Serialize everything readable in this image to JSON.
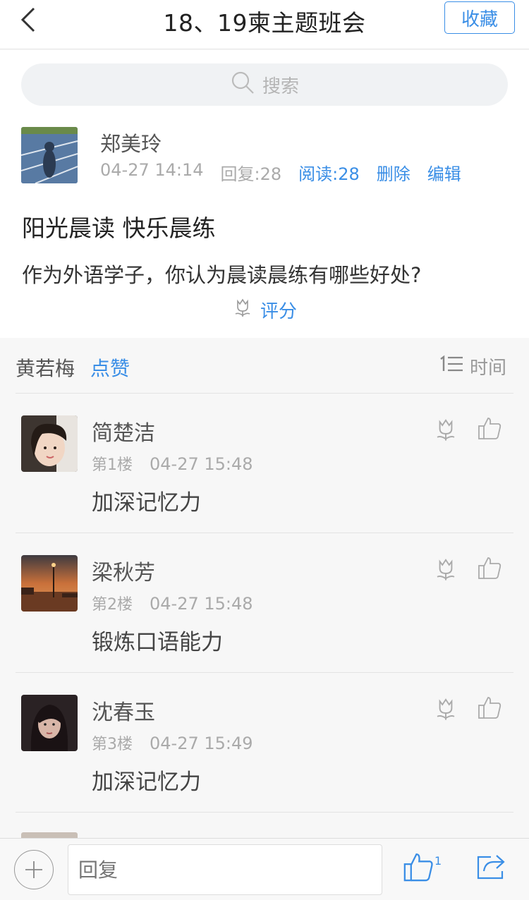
{
  "header": {
    "title": "18、19柬主题班会",
    "favorite_label": "收藏"
  },
  "search": {
    "placeholder": "搜索"
  },
  "post": {
    "author": "郑美玲",
    "date": "04-27 14:14",
    "replies": "回复:28",
    "reads": "阅读:28",
    "delete_label": "删除",
    "edit_label": "编辑",
    "title": "阳光晨读 快乐晨练",
    "body": "作为外语学子，你认为晨读晨练有哪些好处?",
    "rate_label": "评分"
  },
  "filter": {
    "liker": "黄若梅",
    "like_label": "点赞",
    "sort_label": "时间"
  },
  "replies": [
    {
      "name": "简楚洁",
      "floor": "第1楼",
      "time": "04-27 15:48",
      "content": "加深记忆力"
    },
    {
      "name": "梁秋芳",
      "floor": "第2楼",
      "time": "04-27 15:48",
      "content": "锻炼口语能力"
    },
    {
      "name": "沈春玉",
      "floor": "第3楼",
      "time": "04-27 15:49",
      "content": "加深记忆力"
    }
  ],
  "bottom": {
    "reply_placeholder": "回复",
    "like_count": "1"
  },
  "colors": {
    "accent": "#3a8ee6",
    "text": "#333333",
    "muted": "#aaaaaa",
    "background": "#f7f7f7"
  }
}
